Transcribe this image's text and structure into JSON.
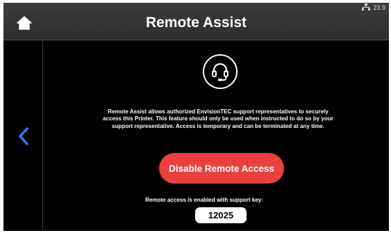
{
  "status_bar": {
    "time": "23.9",
    "network_icon": "network-icon"
  },
  "header": {
    "title": "Remote Assist",
    "home_icon": "home-icon"
  },
  "nav": {
    "back_icon": "chevron-left-icon"
  },
  "main": {
    "support_icon": "headset-support-icon",
    "description": "Remote Assist allows authorized EnvisionTEC support representatives to securely access this Printer. This feature should only be used when instructed to do so by your support representative. Access is temporary and can be terminated at any time.",
    "disable_button_label": "Disable Remote Access",
    "key_label": "Remote access is enabled with support key:",
    "support_key": "12025"
  },
  "colors": {
    "background": "#000000",
    "header": "#333333",
    "accent_red": "#e8413d",
    "back_chevron": "#2f7cf6"
  }
}
